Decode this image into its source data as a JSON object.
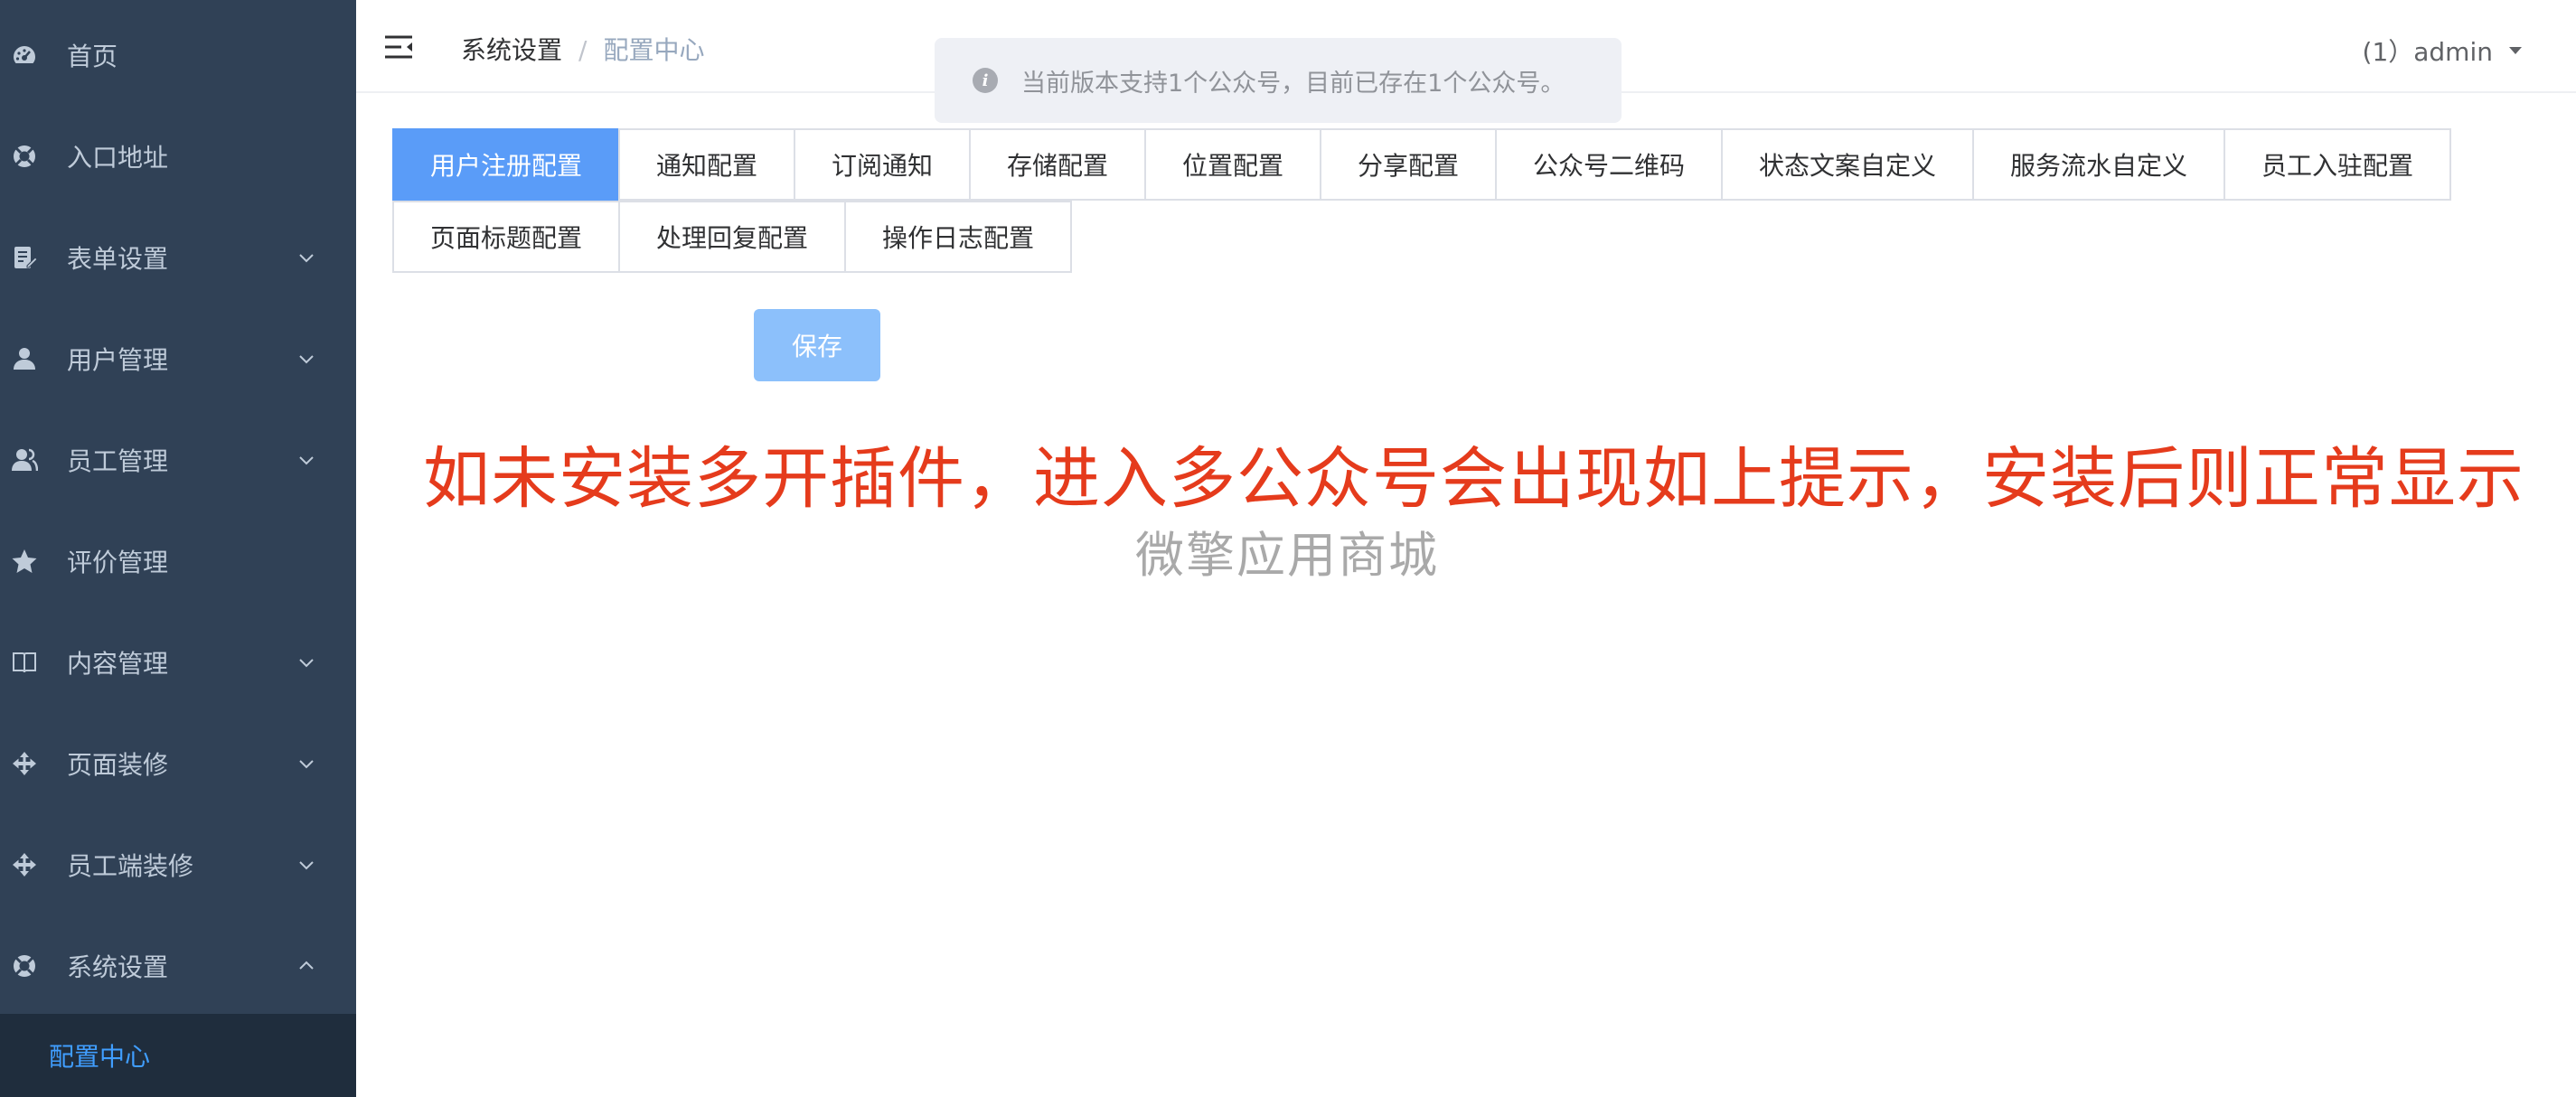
{
  "sidebar": {
    "items": [
      {
        "label": "首页",
        "icon": "dashboard-icon",
        "has_arrow": false,
        "expanded": false
      },
      {
        "label": "入口地址",
        "icon": "lifebuoy-icon",
        "has_arrow": false,
        "expanded": false
      },
      {
        "label": "表单设置",
        "icon": "form-edit-icon",
        "has_arrow": true,
        "expanded": false
      },
      {
        "label": "用户管理",
        "icon": "user-icon",
        "has_arrow": true,
        "expanded": false
      },
      {
        "label": "员工管理",
        "icon": "users-icon",
        "has_arrow": true,
        "expanded": false
      },
      {
        "label": "评价管理",
        "icon": "star-icon",
        "has_arrow": false,
        "expanded": false
      },
      {
        "label": "内容管理",
        "icon": "book-icon",
        "has_arrow": true,
        "expanded": false
      },
      {
        "label": "页面装修",
        "icon": "move-icon",
        "has_arrow": true,
        "expanded": false
      },
      {
        "label": "员工端装修",
        "icon": "move-icon",
        "has_arrow": true,
        "expanded": false
      },
      {
        "label": "系统设置",
        "icon": "lifebuoy-icon",
        "has_arrow": true,
        "expanded": true
      }
    ],
    "sub_item": "配置中心",
    "bg_color": "#304156",
    "active_color": "#409eff"
  },
  "header": {
    "breadcrumb": [
      "系统设置",
      "配置中心"
    ],
    "separator": "/",
    "user": "(1）admin"
  },
  "notice": {
    "text": "当前版本支持1个公众号，目前已存在1个公众号。"
  },
  "tabs": [
    "用户注册配置",
    "通知配置",
    "订阅通知",
    "存储配置",
    "位置配置",
    "分享配置",
    "公众号二维码",
    "状态文案自定义",
    "服务流水自定义",
    "员工入驻配置",
    "页面标题配置",
    "处理回复配置",
    "操作日志配置"
  ],
  "active_tab": "用户注册配置",
  "save_label": "保存",
  "annotation": "如未安装多开插件，进入多公众号会出现如上提示，安装后则正常显示",
  "watermark": "微擎应用商城",
  "colors": {
    "accent": "#5a9cf8",
    "annotation": "#e53b1c"
  }
}
